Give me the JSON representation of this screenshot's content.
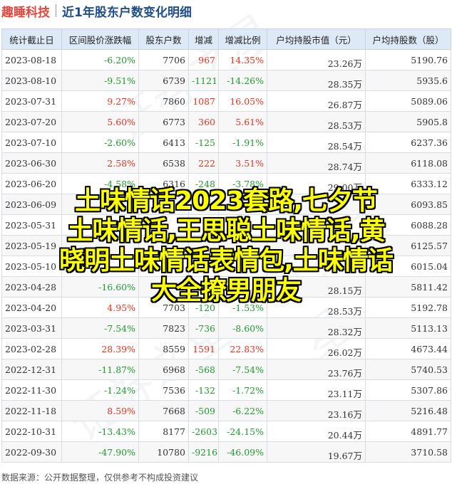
{
  "header": {
    "brand": "趣睡科技",
    "title": "近1年股东户数变化明细"
  },
  "table": {
    "columns": [
      "统计截止日",
      "区间股价涨跌幅",
      "股东户数",
      "增减",
      "增减比例",
      "户均持股市值（元）",
      "户均持股数（股）"
    ],
    "rows": [
      {
        "date": "2023-08-18",
        "pct": "-6.20%",
        "holders": "7706",
        "change": "967",
        "ratio": "14.35%",
        "avg_value": "23.26万",
        "avg_shares": "5190.76"
      },
      {
        "date": "2023-08-10",
        "pct": "-9.51%",
        "holders": "6739",
        "change": "-1121",
        "ratio": "-14.26%",
        "avg_value": "28.35万",
        "avg_shares": "5935.6"
      },
      {
        "date": "2023-07-31",
        "pct": "9.27%",
        "holders": "7860",
        "change": "1087",
        "ratio": "16.05%",
        "avg_value": "26.87万",
        "avg_shares": "5089.06"
      },
      {
        "date": "2023-07-20",
        "pct": "5.60%",
        "holders": "6773",
        "change": "360",
        "ratio": "5.61%",
        "avg_value": "28.53万",
        "avg_shares": "5905.8"
      },
      {
        "date": "2023-07-10",
        "pct": "-2.60%",
        "holders": "6413",
        "change": "-125",
        "ratio": "-1.91%",
        "avg_value": "28.54万",
        "avg_shares": "6237.36"
      },
      {
        "date": "2023-06-30",
        "pct": "2.58%",
        "holders": "6538",
        "change": "222",
        "ratio": "3.51%",
        "avg_value": "28.74万",
        "avg_shares": "6118.08"
      },
      {
        "date": "2023-06-20",
        "pct": "-4.58%",
        "holders": "6316",
        "change": "-248",
        "ratio": "-3.78%",
        "avg_value": "29.00万",
        "avg_shares": "6333.12"
      },
      {
        "date": "2023-06-09",
        "pct": "",
        "holders": "",
        "change": "",
        "ratio": "",
        "avg_value": "",
        "avg_shares": "6093.85"
      },
      {
        "date": "2023-05-31",
        "pct": "",
        "holders": "",
        "change": "",
        "ratio": "",
        "avg_value": "",
        "avg_shares": "6088.28"
      },
      {
        "date": "2023-05-19",
        "pct": "",
        "holders": "",
        "change": "",
        "ratio": "",
        "avg_value": "",
        "avg_shares": "6125.57"
      },
      {
        "date": "2023-05-10",
        "pct": "",
        "holders": "",
        "change": "",
        "ratio": "",
        "avg_value": "",
        "avg_shares": "6015.04"
      },
      {
        "date": "2023-04-28",
        "pct": "-16.60%",
        "holders": "",
        "change": "",
        "ratio": "",
        "avg_value": "28.15万",
        "avg_shares": "5811.42"
      },
      {
        "date": "2023-04-20",
        "pct": "4.95%",
        "holders": "7703",
        "change": "-120",
        "ratio": "-1.53%",
        "avg_value": "28.53万",
        "avg_shares": "5192.78"
      },
      {
        "date": "2023-03-31",
        "pct": "-7.54%",
        "holders": "7823",
        "change": "-736",
        "ratio": "-8.60%",
        "avg_value": "28.32万",
        "avg_shares": "5113.13"
      },
      {
        "date": "2023-02-28",
        "pct": "28.39%",
        "holders": "8559",
        "change": "1591",
        "ratio": "22.83%",
        "avg_value": "26.02万",
        "avg_shares": "4673.44"
      },
      {
        "date": "2022-12-31",
        "pct": "-11.87%",
        "holders": "6968",
        "change": "-568",
        "ratio": "-7.54%",
        "avg_value": "23.76万",
        "avg_shares": "5740.53"
      },
      {
        "date": "2022-11-30",
        "pct": "-1.24%",
        "holders": "7536",
        "change": "-132",
        "ratio": "-1.72%",
        "avg_value": "23.11万",
        "avg_shares": "5307.86"
      },
      {
        "date": "2022-11-18",
        "pct": "8.59%",
        "holders": "7668",
        "change": "-509",
        "ratio": "-6.22%",
        "avg_value": "23.16万",
        "avg_shares": "5216.48"
      },
      {
        "date": "2022-10-31",
        "pct": "-13.43%",
        "holders": "8177",
        "change": "-2603",
        "ratio": "-24.15%",
        "avg_value": "20.44万",
        "avg_shares": "4891.77"
      },
      {
        "date": "2022-09-30",
        "pct": "-47.90%",
        "holders": "10780",
        "change": "-9216",
        "ratio": "-46.09%",
        "avg_value": "19.67万",
        "avg_shares": "3710.58"
      }
    ]
  },
  "footer": "数据来源：公开数据整理，仅供参考不构成投资建议",
  "overlay_text": "土味情话2023套路,七夕节\n土味情话,王思聪土味情话,黄\n晓明土味情话表情包,土味情话\n大全撩男朋友",
  "colors": {
    "up": "#e8321e",
    "down": "#1f9a2e",
    "header_bg": "#dde9f6",
    "brand": "#e8453c",
    "title": "#1e4e8c"
  }
}
